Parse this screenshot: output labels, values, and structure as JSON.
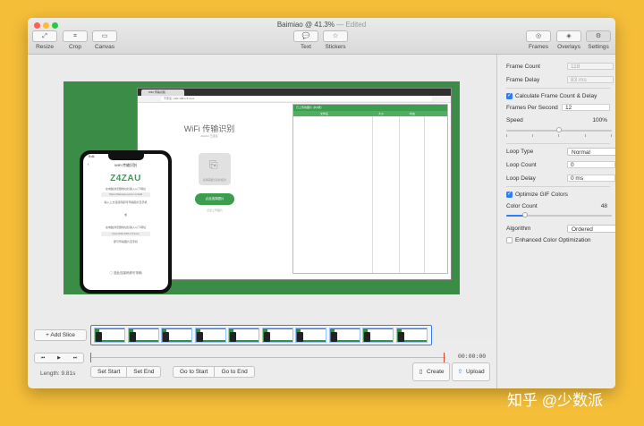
{
  "window": {
    "title": "Baimiao @ 41.3%",
    "edited": "— Edited"
  },
  "toolbar": {
    "left": [
      {
        "label": "Resize",
        "icon": "⤢"
      },
      {
        "label": "Crop",
        "icon": "⌗"
      },
      {
        "label": "Canvas",
        "icon": "▭"
      }
    ],
    "center": [
      {
        "label": "Text",
        "icon": "💬"
      },
      {
        "label": "Stickers",
        "icon": "☆"
      }
    ],
    "right": [
      {
        "label": "Frames",
        "icon": "◎"
      },
      {
        "label": "Overlays",
        "icon": "◈"
      },
      {
        "label": "Settings",
        "icon": "⚙"
      }
    ]
  },
  "preview": {
    "browser_tab": "WiFi 传输识别",
    "browser_url": "不安全 | 192.168.1.5:xxxx",
    "wifi_title": "WiFi 传输识别",
    "wifi_sub": "Z4ZAU 已连接",
    "upload_text": "选择需要识别的图片",
    "select_button": "点此选择图片",
    "note": "点击上传图片",
    "panel_header": "已上传的图片 (共0张)",
    "panel_cols": [
      "文件名",
      "大小",
      "状态"
    ],
    "phone_time": "9:41",
    "phone_header": "WiFi 传输识别",
    "phone_code": "Z4ZAU",
    "phone_lines": [
      "在电脑浏览器地址栏输入以下网址",
      "https://baimiao.uzero.cn/wifi",
      "输入上方连接码即可传输图片至手机",
      "或",
      "在电脑浏览器地址栏输入以下网址",
      "http://192.168.1.5:xxxx",
      "即可传输图片至手机"
    ],
    "phone_check": "◯ 选此连接码即可传输"
  },
  "settings": {
    "frame_count": {
      "label": "Frame Count",
      "value": "118"
    },
    "frame_delay": {
      "label": "Frame Delay",
      "value": "83 ms"
    },
    "calc_frame": {
      "label": "Calculate Frame Count & Delay",
      "checked": true
    },
    "fps": {
      "label": "Frames Per Second",
      "value": "12"
    },
    "speed": {
      "label": "Speed",
      "value": "100%",
      "level": 0.5
    },
    "loop_type": {
      "label": "Loop Type",
      "value": "Normal"
    },
    "loop_count": {
      "label": "Loop Count",
      "value": "0"
    },
    "loop_delay": {
      "label": "Loop Delay",
      "value": "0 ms"
    },
    "optimize": {
      "label": "Optimize GIF Colors",
      "checked": true
    },
    "color_count": {
      "label": "Color Count",
      "value": "48",
      "level": 0.18
    },
    "algorithm": {
      "label": "Algorithm",
      "value": "Ordered"
    },
    "enhanced": {
      "label": "Enhanced Color Optimization",
      "checked": false
    }
  },
  "bottom": {
    "add_slice": "+ Add Slice",
    "timecode": "00:00:00",
    "length": "Length: 9.81s",
    "transport": [
      "⏮",
      "▶",
      "⏭"
    ],
    "set_buttons": [
      "Set Start",
      "Set End"
    ],
    "go_buttons": [
      "Go to Start",
      "Go to End"
    ],
    "create": "Create",
    "upload": "Upload"
  },
  "watermark": "知乎 @少数派",
  "colors": {
    "background": "#F5BE39",
    "accent": "#2f7ef6",
    "green": "#3a8c47"
  }
}
